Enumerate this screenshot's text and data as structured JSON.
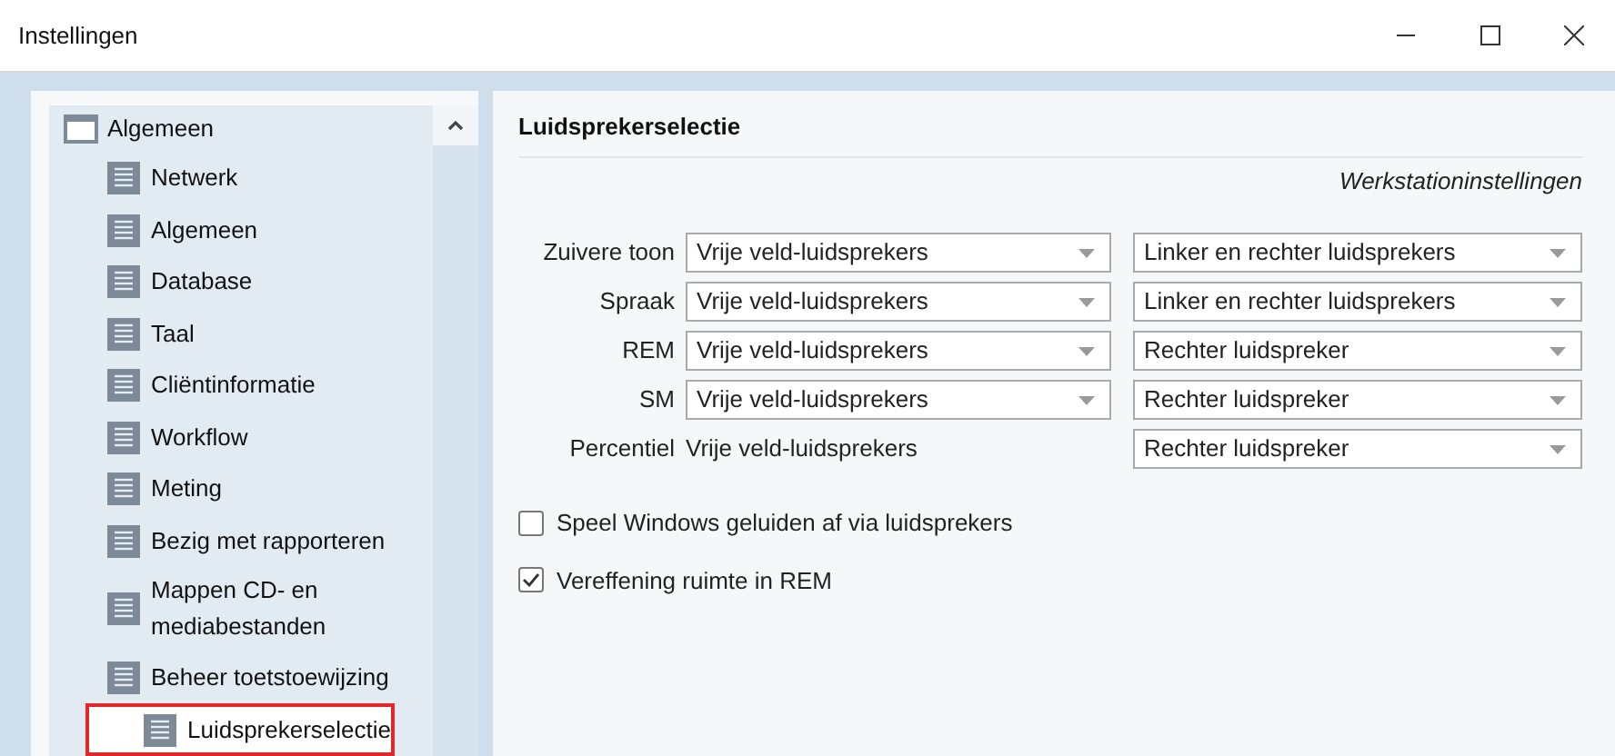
{
  "window": {
    "title": "Instellingen"
  },
  "tree": {
    "label": "Algemeen",
    "children": [
      {
        "label": "Netwerk",
        "selected": false
      },
      {
        "label": "Algemeen",
        "selected": false
      },
      {
        "label": "Database",
        "selected": false
      },
      {
        "label": "Taal",
        "selected": false
      },
      {
        "label": "Cliëntinformatie",
        "selected": false
      },
      {
        "label": "Workflow",
        "selected": false
      },
      {
        "label": "Meting",
        "selected": false
      },
      {
        "label": "Bezig met rapporteren",
        "selected": false
      },
      {
        "label": "Mappen CD- en mediabestanden",
        "selected": false
      },
      {
        "label": "Beheer toetstoewijzing",
        "selected": false
      },
      {
        "label": "Luidsprekerselectie",
        "selected": true
      }
    ]
  },
  "section": {
    "title": "Luidsprekerselectie",
    "subtitle": "Werkstationinstellingen"
  },
  "rows": [
    {
      "label": "Zuivere toon",
      "source": {
        "kind": "dropdown",
        "value": "Vrije veld-luidsprekers"
      },
      "output": {
        "kind": "dropdown",
        "value": "Linker en rechter luidsprekers"
      }
    },
    {
      "label": "Spraak",
      "source": {
        "kind": "dropdown",
        "value": "Vrije veld-luidsprekers"
      },
      "output": {
        "kind": "dropdown",
        "value": "Linker en rechter luidsprekers"
      }
    },
    {
      "label": "REM",
      "source": {
        "kind": "dropdown",
        "value": "Vrije veld-luidsprekers"
      },
      "output": {
        "kind": "dropdown",
        "value": "Rechter luidspreker"
      }
    },
    {
      "label": "SM",
      "source": {
        "kind": "dropdown",
        "value": "Vrije veld-luidsprekers"
      },
      "output": {
        "kind": "dropdown",
        "value": "Rechter luidspreker"
      }
    },
    {
      "label": "Percentiel",
      "source": {
        "kind": "text",
        "value": "Vrije veld-luidsprekers"
      },
      "output": {
        "kind": "dropdown",
        "value": "Rechter luidspreker"
      }
    }
  ],
  "checkboxes": [
    {
      "label": "Speel Windows geluiden af via luidsprekers",
      "checked": false
    },
    {
      "label": "Vereffening ruimte in REM",
      "checked": true
    }
  ]
}
